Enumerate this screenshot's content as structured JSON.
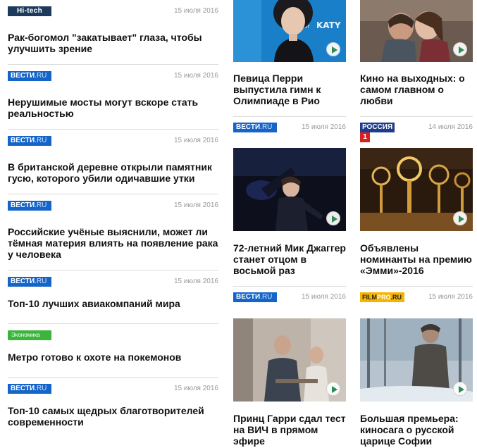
{
  "news_list": [
    {
      "source": "Hi-tech",
      "date": "15 июля 2016",
      "headline": "Рак-богомол \"закатывает\" глаза, чтобы улучшить зрение"
    },
    {
      "source": "ВЕСТИ.RU",
      "date": "15 июля 2016",
      "headline": "Нерушимые мосты могут вскоре стать реальностью"
    },
    {
      "source": "ВЕСТИ.RU",
      "date": "15 июля 2016",
      "headline": "В британской деревне открыли памятник гусю, которого убили одичавшие утки"
    },
    {
      "source": "ВЕСТИ.RU",
      "date": "15 июля 2016",
      "headline": "Российские учёные выяснили, может ли тёмная материя влиять на появление рака у человека"
    },
    {
      "source": "ВЕСТИ.RU",
      "date": "15 июля 2016",
      "headline": "Топ-10 лучших авиакомпаний мира"
    },
    {
      "source": "Экономика",
      "date": "",
      "headline": "Метро готово к охоте на покемонов"
    },
    {
      "source": "ВЕСТИ.RU",
      "date": "15 июля 2016",
      "headline": "Топ-10 самых щедрых благотворителей современности"
    }
  ],
  "badges": {
    "hitech": "Hi-tech",
    "vesti_main": "ВЕСТИ",
    "vesti_ru": ".RU",
    "econ": "Экономика",
    "rossia_text": "РОССИЯ",
    "rossia_num": "1",
    "film_main": "FILM",
    "film_pro": "PRO",
    "film_ru": ".RU"
  },
  "cards_col_a": [
    {
      "title": "Певица Перри выпустила гимн к Олимпиаде в Рио",
      "source": "ВЕСТИ.RU",
      "date": "15 июля 2016",
      "thumb": "katy-perry-photo"
    },
    {
      "title": "72-летний Мик Джаггер станет отцом в восьмой раз",
      "source": "ВЕСТИ.RU",
      "date": "15 июля 2016",
      "thumb": "mick-jagger-photo"
    },
    {
      "title": "Принц Гарри сдал тест на ВИЧ в прямом эфире",
      "source": "",
      "date": "",
      "thumb": "prince-harry-photo"
    }
  ],
  "cards_col_b": [
    {
      "title": "Кино на выходных: о самом главном  о любви",
      "source": "РОССИЯ 1",
      "date": "14 июля 2016",
      "thumb": "movie-kiss-photo"
    },
    {
      "title": "Объявлены номинанты на премию «Эмми»-2016",
      "source": "FILMPRO.RU",
      "date": "15 июля 2016",
      "thumb": "emmy-statues-photo"
    },
    {
      "title": "Большая премьера: киносага о русской царице Софии",
      "source": "",
      "date": "",
      "thumb": "tsarina-sofia-photo"
    }
  ],
  "colors": {
    "hitech": "#1c3b5c",
    "vesti": "#1565c8",
    "econ": "#3bb53b",
    "rossia_blue": "#1f3c8a",
    "rossia_red": "#d8201e",
    "filmpro": "#f5b400",
    "date_text": "#999999"
  },
  "icons": {
    "play": "play-icon"
  }
}
